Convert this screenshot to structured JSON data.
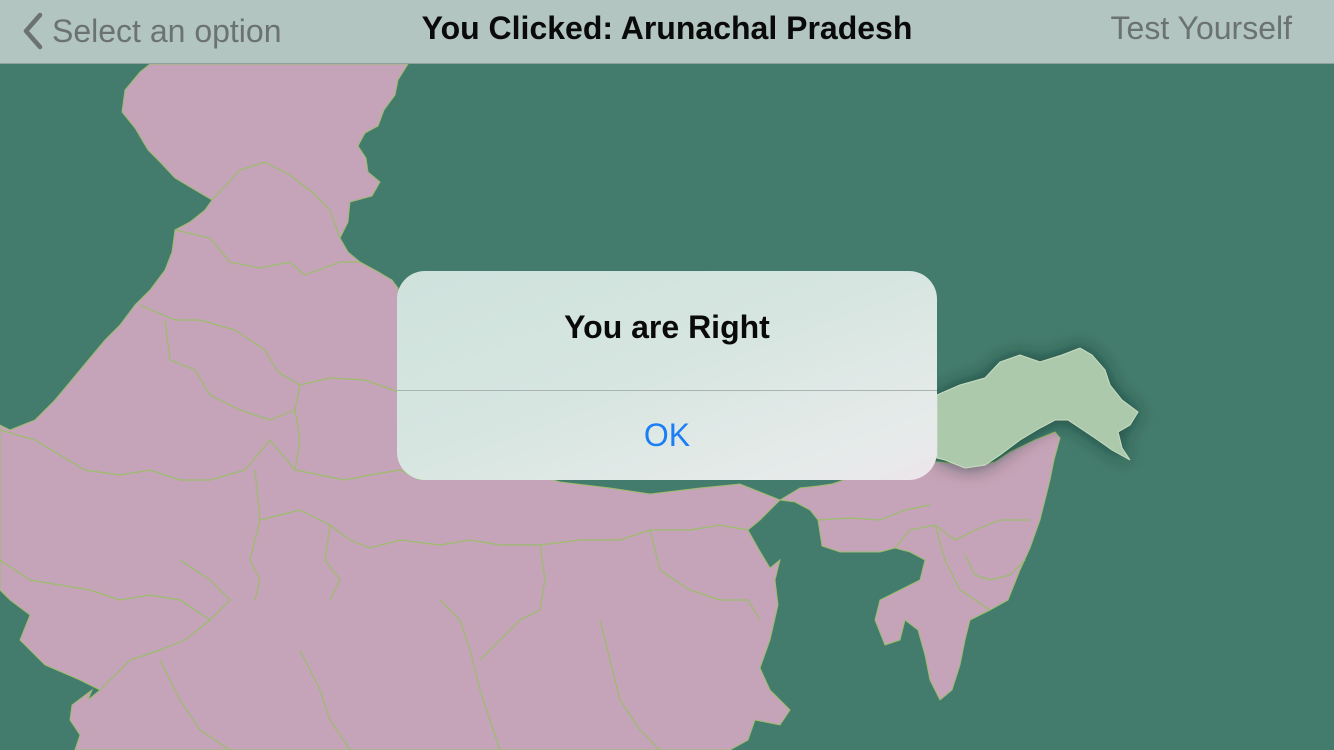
{
  "nav": {
    "back_label": "Select an option",
    "title": "You Clicked: Arunachal Pradesh",
    "right_label": "Test Yourself"
  },
  "alert": {
    "title": "You are Right",
    "ok_label": "OK"
  },
  "map": {
    "selected_region": "Arunachal Pradesh",
    "colors": {
      "sea": "#437b6c",
      "land": "#c5a3b8",
      "borders": "#9bbd6c",
      "highlight": "#adc9ab",
      "nav_bar": "#b3c5c1",
      "alert_button": "#1a7ef5"
    }
  }
}
